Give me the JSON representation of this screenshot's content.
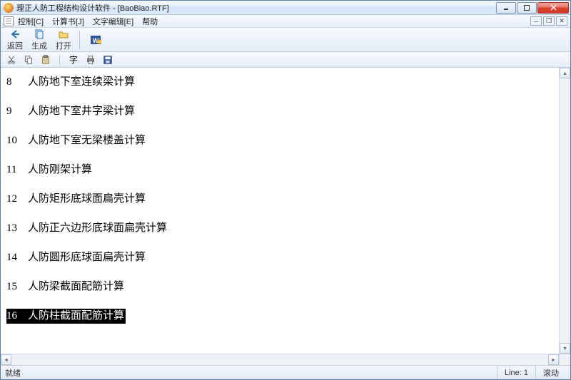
{
  "window": {
    "title": "理正人防工程结构设计软件 - [BaoBiao.RTF]"
  },
  "menu": {
    "control": "控制[C]",
    "calcbook": "计算书[J]",
    "textedit": "文字编辑[E]",
    "help": "帮助"
  },
  "toolbar": {
    "back": "返回",
    "generate": "生成",
    "open": "打开"
  },
  "doc": {
    "lines": [
      {
        "num": "8",
        "text": "人防地下室连续梁计算"
      },
      {
        "num": "9",
        "text": "人防地下室井字梁计算"
      },
      {
        "num": "10",
        "text": "人防地下室无梁楼盖计算"
      },
      {
        "num": "11",
        "text": "人防刚架计算"
      },
      {
        "num": "12",
        "text": "人防矩形底球面扁壳计算"
      },
      {
        "num": "13",
        "text": "人防正六边形底球面扁壳计算"
      },
      {
        "num": "14",
        "text": "人防圆形底球面扁壳计算"
      },
      {
        "num": "15",
        "text": "人防梁截面配筋计算"
      },
      {
        "num": "16",
        "text": "人防柱截面配筋计算"
      }
    ],
    "selected_index": 8
  },
  "status": {
    "ready": "就绪",
    "line": "Line: 1",
    "scroll": "滚动"
  }
}
